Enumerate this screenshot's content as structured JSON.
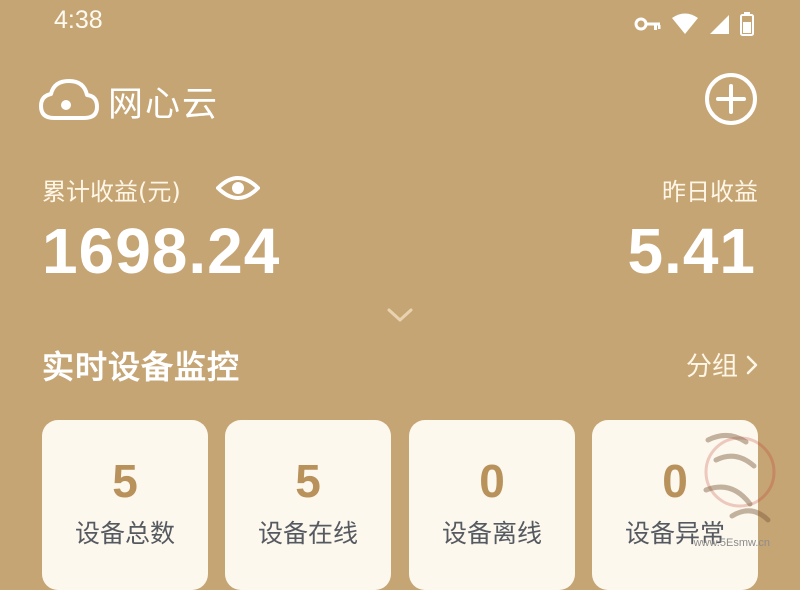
{
  "status_bar": {
    "time": "4:38"
  },
  "header": {
    "title": "网心云"
  },
  "earnings": {
    "total_label": "累计收益(元)",
    "total_value": "1698.24",
    "yesterday_label": "昨日收益",
    "yesterday_value": "5.41"
  },
  "monitor": {
    "title": "实时设备监控",
    "group_link": "分组",
    "cards": [
      {
        "value": "5",
        "label": "设备总数"
      },
      {
        "value": "5",
        "label": "设备在线"
      },
      {
        "value": "0",
        "label": "设备离线"
      },
      {
        "value": "0",
        "label": "设备异常"
      }
    ]
  },
  "watermark": {
    "url": "www.5Esmw.cn"
  },
  "colors": {
    "background": "#c6a575",
    "card": "#fdf8ee",
    "card_value": "#b8915b",
    "card_label": "#555a60"
  }
}
